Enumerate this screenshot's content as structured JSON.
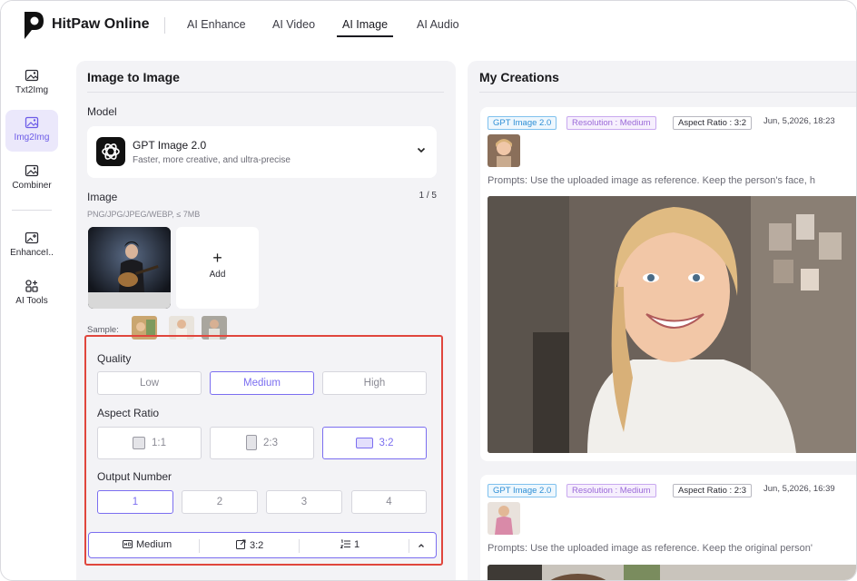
{
  "app": {
    "brand": "HitPaw Online",
    "nav": [
      "AI Enhance",
      "AI Video",
      "AI Image",
      "AI Audio"
    ],
    "active_nav": "AI Image"
  },
  "sidebar": {
    "items": [
      {
        "label": "Txt2Img",
        "icon": "image-text-icon"
      },
      {
        "label": "Img2Img",
        "icon": "image-convert-icon"
      },
      {
        "label": "Combiner",
        "icon": "image-combine-icon"
      },
      {
        "label": "EnhanceI..",
        "icon": "image-enhance-icon"
      },
      {
        "label": "AI Tools",
        "icon": "tools-grid-icon"
      }
    ],
    "active": "Img2Img"
  },
  "panel": {
    "title": "Image to Image",
    "model_label": "Model",
    "model_name": "GPT Image 2.0",
    "model_desc": "Faster, more creative, and ultra-precise",
    "image_label": "Image",
    "image_count": "1 / 5",
    "image_hint": "PNG/JPG/JPEG/WEBP, ≤ 7MB",
    "add_label": "Add",
    "sample_label": "Sample:"
  },
  "settings": {
    "quality_label": "Quality",
    "quality_options": [
      "Low",
      "Medium",
      "High"
    ],
    "quality_selected": "Medium",
    "aspect_label": "Aspect Ratio",
    "aspect_options": [
      "1:1",
      "2:3",
      "3:2"
    ],
    "aspect_selected": "3:2",
    "output_label": "Output Number",
    "output_options": [
      "1",
      "2",
      "3",
      "4"
    ],
    "output_selected": "1"
  },
  "summary": {
    "quality": "Medium",
    "ratio": "3:2",
    "count": "1"
  },
  "creations": {
    "title": "My Creations",
    "cards": [
      {
        "model_tag": "GPT Image 2.0",
        "resolution_tag": "Resolution : Medium",
        "ratio_tag": "Aspect Ratio : 3:2",
        "date": "Jun, 5,2026, 18:23",
        "prompt": "Prompts: Use the uploaded image as reference. Keep the person's face, h"
      },
      {
        "model_tag": "GPT Image 2.0",
        "resolution_tag": "Resolution : Medium",
        "ratio_tag": "Aspect Ratio : 2:3",
        "date": "Jun, 5,2026, 16:39",
        "prompt": "Prompts: Use the uploaded image as reference. Keep the original person'"
      }
    ]
  },
  "colors": {
    "accent": "#7b6ef0",
    "highlight_border": "#e0463d",
    "panel_bg": "#f3f3f6"
  }
}
